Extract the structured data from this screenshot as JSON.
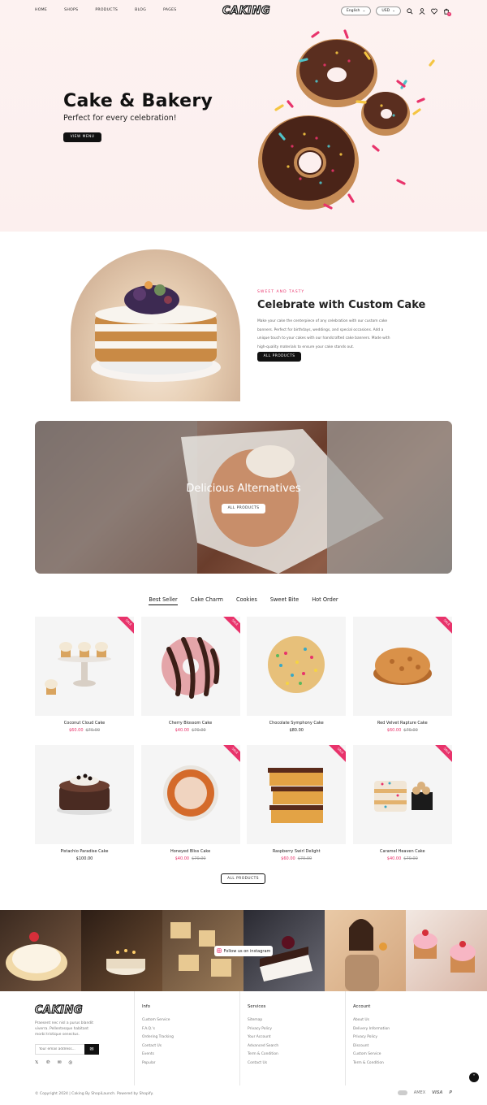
{
  "header": {
    "logo": "CAKING",
    "nav": [
      "HOME",
      "SHOPS",
      "PRODUCTS",
      "BLOG",
      "PAGES"
    ],
    "language": "English",
    "currency": "USD",
    "cart_count": "0"
  },
  "hero": {
    "title": "Cake & Bakery",
    "subtitle": "Perfect for every celebration!",
    "button": "VIEW MENU"
  },
  "custom": {
    "eyebrow": "SWEET AND TASTY",
    "title": "Celebrate with Custom Cake",
    "text": "Make your cake the centerpiece of any celebration with our custom cake banners. Perfect for birthdays, weddings, and special occasions. Add a unique touch to your cakes with our handcrafted cake banners. Made with high-quality materials to ensure your cake stands out.",
    "button": "ALL PRODUCTS"
  },
  "banner": {
    "title": "Delicious Alternatives",
    "button": "ALL PRODUCTS"
  },
  "tabs": [
    "Best Seller",
    "Cake Charm",
    "Cookies",
    "Sweet Bite",
    "Hot Order"
  ],
  "products": [
    {
      "name": "Coconut Cloud Cake",
      "price": "$60.00",
      "old": "$70.00",
      "sale": "SALE"
    },
    {
      "name": "Cherry Blossom Cake",
      "price": "$40.00",
      "old": "$70.00",
      "sale": "SALE"
    },
    {
      "name": "Chocolate Symphony Cake",
      "price": "$80.00",
      "old": "",
      "sale": ""
    },
    {
      "name": "Red Velvet Rapture Cake",
      "price": "$60.00",
      "old": "$70.00",
      "sale": "SALE"
    },
    {
      "name": "Pistachio Paradise Cake",
      "price": "$100.00",
      "old": "",
      "sale": ""
    },
    {
      "name": "Honeyed Bliss Cake",
      "price": "$40.00",
      "old": "$70.00",
      "sale": "SALE"
    },
    {
      "name": "Raspberry Swirl Delight",
      "price": "$60.00",
      "old": "$70.00",
      "sale": "SALE"
    },
    {
      "name": "Caramel Heaven Cake",
      "price": "$40.00",
      "old": "$70.00",
      "sale": "SALE"
    }
  ],
  "all_products_button": "ALL PRODUCTS",
  "instagram": {
    "label": "Follow us on instagram"
  },
  "footer": {
    "logo": "CAKING",
    "description": "Praesent nec nisl a purus blandit viverra. Pellentesque habitant morbi tristique senectus.",
    "email_placeholder": "Your email address...",
    "cols": [
      {
        "title": "Info",
        "links": [
          "Custom Service",
          "F.A.Q.'s",
          "Ordering Tracking",
          "Contact Us",
          "Events",
          "Popular"
        ]
      },
      {
        "title": "Services",
        "links": [
          "Sitemap",
          "Privacy Policy",
          "Your Account",
          "Advanced Search",
          "Term & Condition",
          "Contact Us"
        ]
      },
      {
        "title": "Account",
        "links": [
          "About Us",
          "Delivery Information",
          "Privacy Policy",
          "Discount",
          "Custom Service",
          "Term & Condition"
        ]
      }
    ],
    "copyright": "© Copyright 2024 | Caking By ShopiLaunch. Powered by Shopify.",
    "payments": [
      "AMEX",
      "VISA",
      "P"
    ]
  },
  "colors": {
    "accent": "#e8336b",
    "dark": "#111111",
    "hero_bg": "#fdf2f1"
  }
}
